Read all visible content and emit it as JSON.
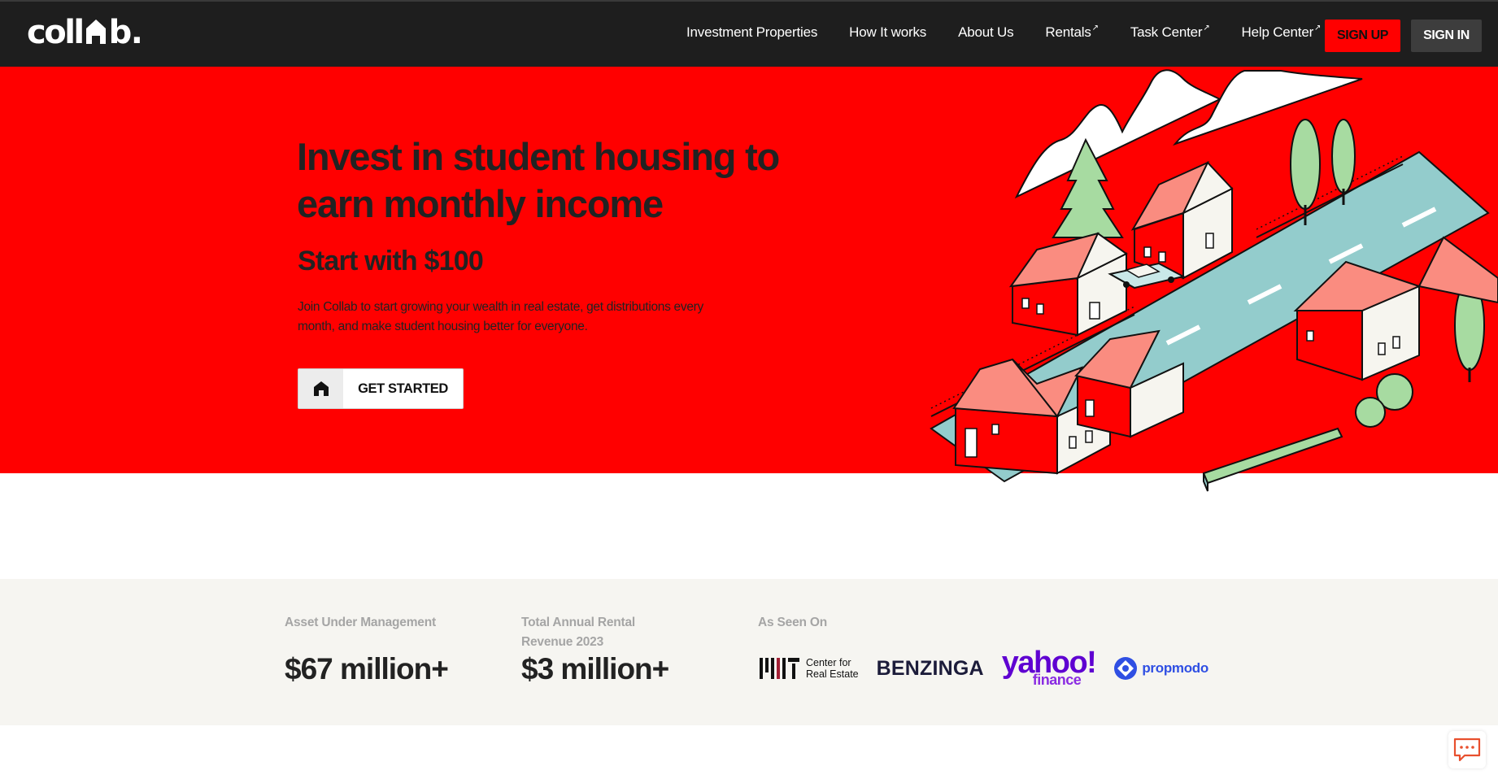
{
  "brand": {
    "logo_prefix": "coll",
    "logo_suffix": "b",
    "logo_dot": ".",
    "logo_name": "collab."
  },
  "nav": {
    "links": [
      {
        "label": "Investment Properties",
        "external": false
      },
      {
        "label": "How It works",
        "external": false
      },
      {
        "label": "About Us",
        "external": false
      },
      {
        "label": "Rentals",
        "external": true
      },
      {
        "label": "Task Center",
        "external": true
      },
      {
        "label": "Help Center",
        "external": true
      }
    ],
    "external_glyph": "↗",
    "signup_label": "SIGN UP",
    "signin_label": "SIGN IN"
  },
  "hero": {
    "title": "Invest in student housing to earn monthly income",
    "subtitle": "Start with $100",
    "description": "Join Collab to start growing your wealth in real estate, get distributions every month, and make student housing better for everyone.",
    "cta_label": "GET STARTED",
    "cta_icon": "home-icon"
  },
  "stats": {
    "aum_label": "Asset Under Management",
    "aum_value": "$67 million+",
    "revenue_label": "Total Annual Rental Revenue 2023",
    "revenue_value": "$3 million+",
    "press_label": "As Seen On",
    "press": {
      "mit_line1": "Center for",
      "mit_line2": "Real Estate",
      "benzinga": "BENZINGA",
      "yahoo_main": "yahoo!",
      "yahoo_sub": "finance",
      "propmodo": "propmodo"
    }
  },
  "colors": {
    "hero_red": "#ff0000",
    "nav_bg": "#1e1e1e",
    "signin_bg": "#3d3d3d",
    "stats_bg": "#f6f5f1",
    "house_roof": "#fa8c80",
    "tree_green": "#a7dba1",
    "road_teal": "#93cccc"
  },
  "chat": {
    "icon": "chat-icon"
  }
}
